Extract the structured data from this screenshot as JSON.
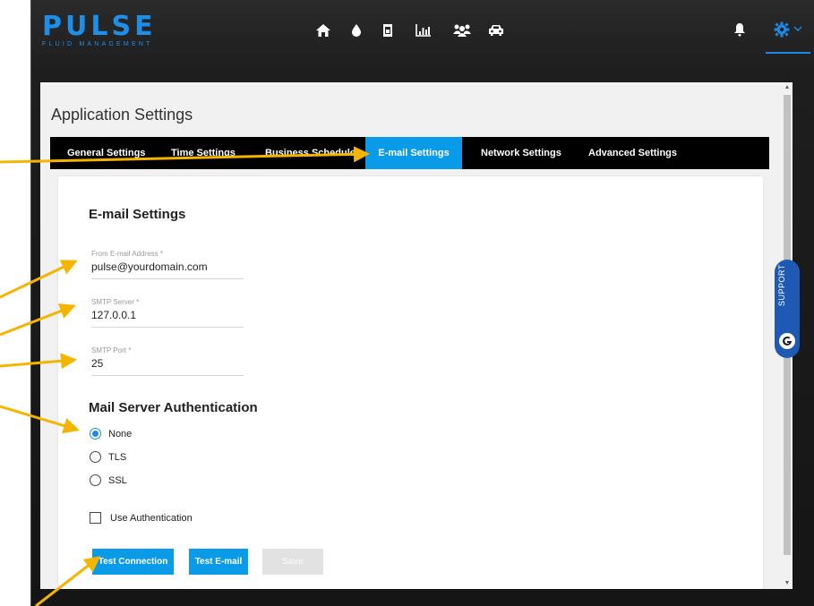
{
  "brand": {
    "name": "PULSE",
    "tm": "™",
    "tagline": "FLUID MANAGEMENT",
    "color": "#1e8fe8"
  },
  "nav": {
    "icons": [
      "home-icon",
      "fluid-drop-icon",
      "tank-meter-icon",
      "bar-chart-icon",
      "users-icon",
      "car-icon"
    ],
    "right": [
      "bell-icon",
      "gear-icon",
      "chevron-down-icon"
    ]
  },
  "page": {
    "title": "Application Settings"
  },
  "tabs": [
    {
      "label": "General Settings",
      "active": false
    },
    {
      "label": "Time Settings",
      "active": false
    },
    {
      "label": "Business Schedule",
      "active": false
    },
    {
      "label": "E-mail Settings",
      "active": true
    },
    {
      "label": "Network Settings",
      "active": false
    },
    {
      "label": "Advanced Settings",
      "active": false
    }
  ],
  "email": {
    "section_title": "E-mail Settings",
    "from": {
      "label": "From E-mail Address *",
      "value": "pulse@yourdomain.com"
    },
    "smtp_server": {
      "label": "SMTP Server *",
      "value": "127.0.0.1"
    },
    "smtp_port": {
      "label": "SMTP Port *",
      "value": "25"
    }
  },
  "auth": {
    "section_title": "Mail Server Authentication",
    "options": [
      {
        "label": "None",
        "checked": true
      },
      {
        "label": "TLS",
        "checked": false
      },
      {
        "label": "SSL",
        "checked": false
      }
    ],
    "use_auth_label": "Use Authentication"
  },
  "buttons": {
    "test_connection": "Test Connection",
    "test_email": "Test E-mail",
    "save": "Save"
  },
  "support": {
    "label": "SUPPORT"
  },
  "colors": {
    "accent": "#0a9be8",
    "annotation_arrow": "#f5b400"
  }
}
